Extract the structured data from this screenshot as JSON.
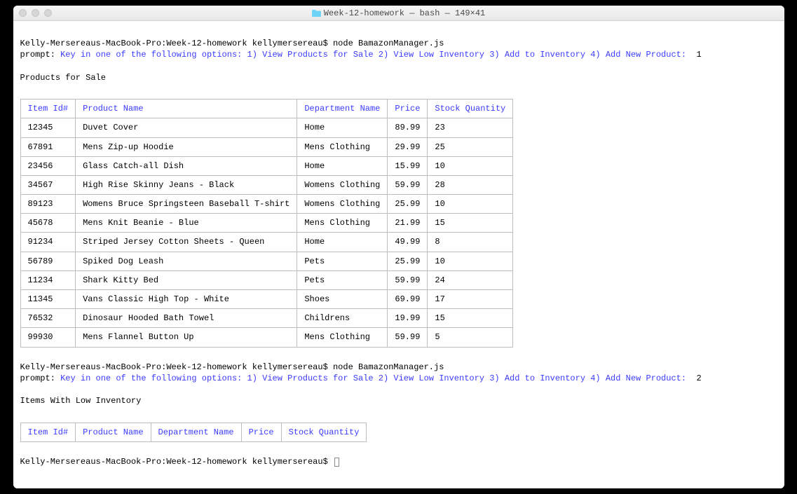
{
  "titlebar": {
    "title": "Week-12-homework — bash — 149×41"
  },
  "shell_prefix": "Kelly-Mersereaus-MacBook-Pro:Week-12-homework kellymersereau$ ",
  "command": "node BamazonManager.js",
  "prompt_label": "prompt: ",
  "prompt_text": "Key in one of the following options: 1) View Products for Sale 2) View Low Inventory 3) Add to Inventory 4) Add New Product:",
  "answer1": "  1",
  "answer2": "  2",
  "section1_title": "Products for Sale",
  "section2_title": "Items With Low Inventory",
  "headers": {
    "id": "Item Id#",
    "name": "Product Name",
    "dept": "Department Name",
    "price": "Price",
    "stock": "Stock Quantity"
  },
  "products": [
    {
      "id": "12345",
      "name": "Duvet Cover",
      "dept": "Home",
      "price": "89.99",
      "stock": "23"
    },
    {
      "id": "67891",
      "name": "Mens Zip-up Hoodie",
      "dept": "Mens Clothing",
      "price": "29.99",
      "stock": "25"
    },
    {
      "id": "23456",
      "name": "Glass Catch-all Dish",
      "dept": "Home",
      "price": "15.99",
      "stock": "10"
    },
    {
      "id": "34567",
      "name": "High Rise Skinny Jeans - Black",
      "dept": "Womens Clothing",
      "price": "59.99",
      "stock": "28"
    },
    {
      "id": "89123",
      "name": "Womens Bruce Springsteen Baseball T-shirt",
      "dept": "Womens Clothing",
      "price": "25.99",
      "stock": "10"
    },
    {
      "id": "45678",
      "name": "Mens Knit Beanie - Blue",
      "dept": "Mens Clothing",
      "price": "21.99",
      "stock": "15"
    },
    {
      "id": "91234",
      "name": "Striped Jersey Cotton Sheets - Queen",
      "dept": "Home",
      "price": "49.99",
      "stock": "8"
    },
    {
      "id": "56789",
      "name": "Spiked Dog Leash",
      "dept": "Pets",
      "price": "25.99",
      "stock": "10"
    },
    {
      "id": "11234",
      "name": "Shark Kitty Bed",
      "dept": "Pets",
      "price": "59.99",
      "stock": "24"
    },
    {
      "id": "11345",
      "name": "Vans Classic High Top - White",
      "dept": "Shoes",
      "price": "69.99",
      "stock": "17"
    },
    {
      "id": "76532",
      "name": "Dinosaur Hooded Bath Towel",
      "dept": "Childrens",
      "price": "19.99",
      "stock": "15"
    },
    {
      "id": "99930",
      "name": "Mens Flannel Button Up",
      "dept": "Mens Clothing",
      "price": "59.99",
      "stock": "5"
    }
  ]
}
